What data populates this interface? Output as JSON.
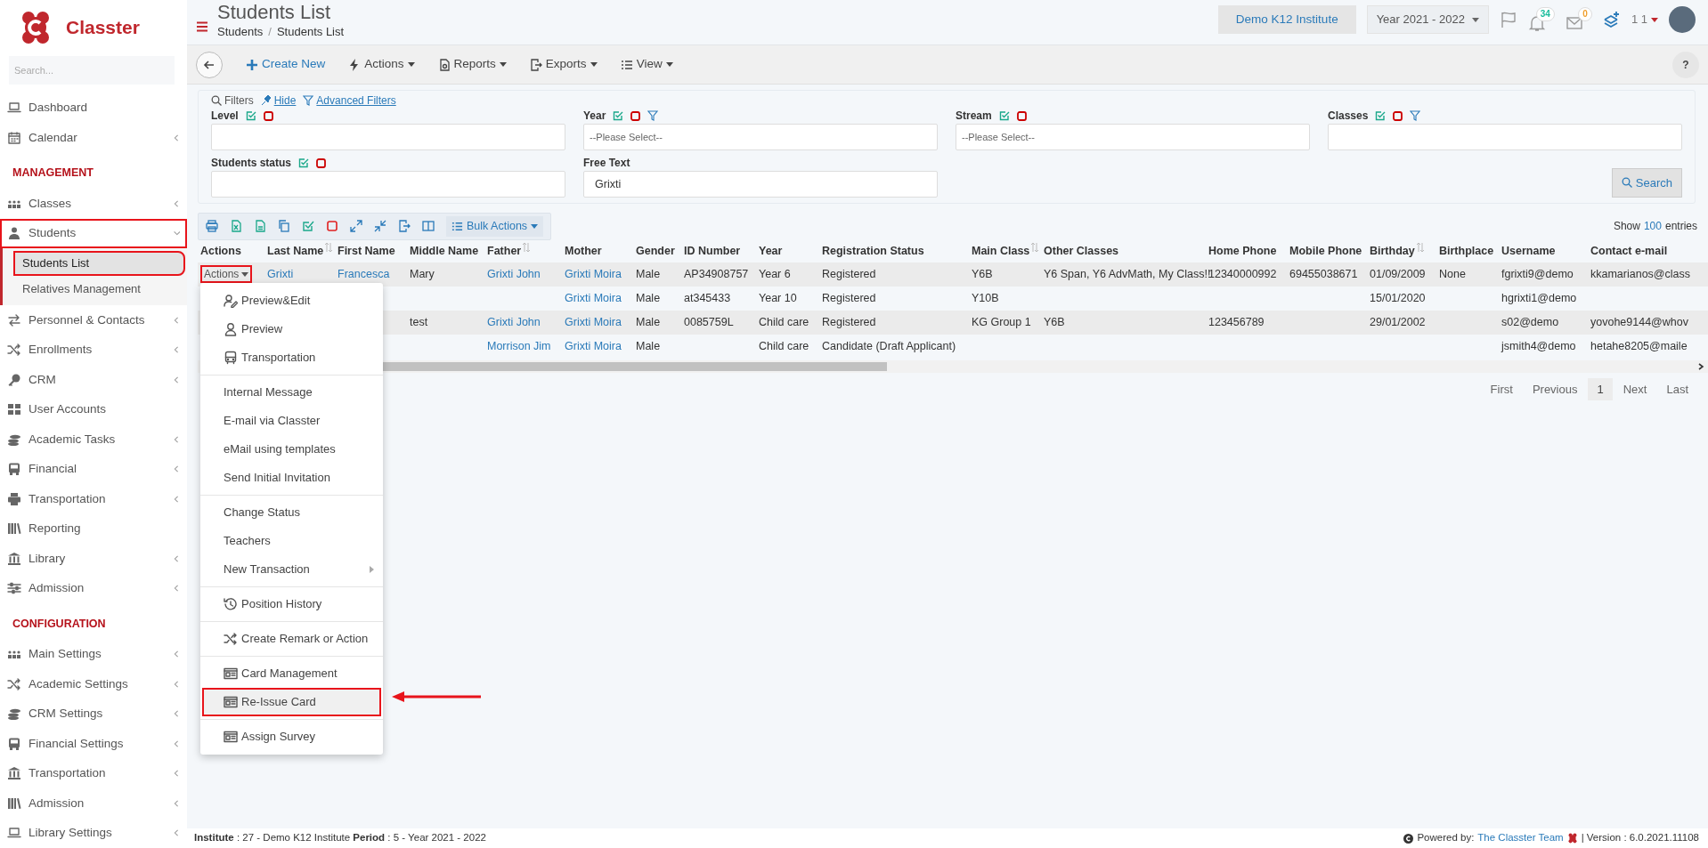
{
  "brand": {
    "name": "Classter"
  },
  "sidebar": {
    "search_placeholder": "Search...",
    "items": [
      {
        "kind": "item",
        "label": "Dashboard",
        "has_submenu": false,
        "highlighted": false
      },
      {
        "kind": "item",
        "label": "Calendar",
        "has_submenu": true,
        "highlighted": false
      },
      {
        "kind": "header",
        "label": "MANAGEMENT"
      },
      {
        "kind": "item",
        "label": "Classes",
        "has_submenu": true,
        "highlighted": false
      },
      {
        "kind": "item",
        "label": "Students",
        "has_submenu": true,
        "highlighted": true,
        "expanded": true,
        "children": [
          {
            "label": "Students List",
            "selected": true,
            "highlighted": true
          },
          {
            "label": "Relatives Management",
            "selected": false,
            "highlighted": false
          }
        ]
      },
      {
        "kind": "item",
        "label": "Personnel & Contacts",
        "has_submenu": true,
        "highlighted": false
      },
      {
        "kind": "item",
        "label": "Enrollments",
        "has_submenu": true,
        "highlighted": false
      },
      {
        "kind": "item",
        "label": "CRM",
        "has_submenu": true,
        "highlighted": false
      },
      {
        "kind": "item",
        "label": "User Accounts",
        "has_submenu": false,
        "highlighted": false
      },
      {
        "kind": "item",
        "label": "Academic Tasks",
        "has_submenu": true,
        "highlighted": false
      },
      {
        "kind": "item",
        "label": "Financial",
        "has_submenu": true,
        "highlighted": false
      },
      {
        "kind": "item",
        "label": "Transportation",
        "has_submenu": true,
        "highlighted": false
      },
      {
        "kind": "item",
        "label": "Reporting",
        "has_submenu": false,
        "highlighted": false
      },
      {
        "kind": "item",
        "label": "Library",
        "has_submenu": true,
        "highlighted": false
      },
      {
        "kind": "item",
        "label": "Admission",
        "has_submenu": true,
        "highlighted": false
      },
      {
        "kind": "header",
        "label": "CONFIGURATION"
      },
      {
        "kind": "item",
        "label": "Main Settings",
        "has_submenu": true,
        "highlighted": false
      },
      {
        "kind": "item",
        "label": "Academic Settings",
        "has_submenu": true,
        "highlighted": false
      },
      {
        "kind": "item",
        "label": "CRM Settings",
        "has_submenu": true,
        "highlighted": false
      },
      {
        "kind": "item",
        "label": "Financial Settings",
        "has_submenu": true,
        "highlighted": false
      },
      {
        "kind": "item",
        "label": "Transportation",
        "has_submenu": true,
        "highlighted": false
      },
      {
        "kind": "item",
        "label": "Admission",
        "has_submenu": true,
        "highlighted": false
      },
      {
        "kind": "item",
        "label": "Library Settings",
        "has_submenu": true,
        "highlighted": false
      }
    ]
  },
  "header": {
    "title": "Students List",
    "breadcrumb": [
      "Students",
      "Students List"
    ],
    "breadcrumb_separator": "/",
    "institute": "Demo K12 Institute",
    "year": "Year 2021 - 2022",
    "notifications_badge": "34",
    "messages_badge": "0",
    "user": "1 1"
  },
  "toolbar": {
    "buttons": [
      {
        "label": "Create New",
        "kind": "create"
      },
      {
        "label": "Actions",
        "kind": "dropdown"
      },
      {
        "label": "Reports",
        "kind": "dropdown"
      },
      {
        "label": "Exports",
        "kind": "dropdown"
      },
      {
        "label": "View",
        "kind": "dropdown"
      }
    ],
    "help": "?"
  },
  "filters": {
    "title": "Filters",
    "hide": "Hide",
    "advanced": "Advanced Filters",
    "search_button": "Search",
    "fields": [
      {
        "label": "Level",
        "has_filter": false
      },
      {
        "label": "Year",
        "has_filter": true,
        "placeholder": "--Please Select--"
      },
      {
        "label": "Stream",
        "has_filter": false,
        "placeholder": "--Please Select--"
      },
      {
        "label": "Classes",
        "has_filter": true
      },
      {
        "label": "Students status",
        "has_filter": false
      },
      {
        "label": "Free Text",
        "has_filter": false,
        "value": "Grixti",
        "plain": true
      }
    ]
  },
  "table_toolbar": {
    "bulk_actions": "Bulk Actions",
    "show": "Show",
    "page_size": "100",
    "entries": "entries"
  },
  "table": {
    "columns": [
      {
        "label": "Actions",
        "sort_icon": false
      },
      {
        "label": "Last Name",
        "sort_icon": true,
        "link": true
      },
      {
        "label": "First Name",
        "sort_icon": false,
        "link": true
      },
      {
        "label": "Middle Name",
        "sort_icon": false
      },
      {
        "label": "Father",
        "sort_icon": true,
        "link": true
      },
      {
        "label": "Mother",
        "sort_icon": false,
        "link": true
      },
      {
        "label": "Gender",
        "sort_icon": false
      },
      {
        "label": "ID Number",
        "sort_icon": false
      },
      {
        "label": "Year",
        "sort_icon": false
      },
      {
        "label": "Registration Status",
        "sort_icon": false
      },
      {
        "label": "Main Class",
        "sort_icon": true
      },
      {
        "label": "Other Classes",
        "sort_icon": false
      },
      {
        "label": "Home Phone",
        "sort_icon": false
      },
      {
        "label": "Mobile Phone",
        "sort_icon": false
      },
      {
        "label": "Birthday",
        "sort_icon": true
      },
      {
        "label": "Birthplace",
        "sort_icon": false
      },
      {
        "label": "Username",
        "sort_icon": false
      },
      {
        "label": "Contact e-mail",
        "sort_icon": false
      }
    ],
    "rows": [
      {
        "actions": {
          "label": "Actions",
          "highlighted": true
        },
        "cells": [
          null,
          "Grixti",
          "Francesca",
          "Mary",
          "Grixti John",
          "Grixti Moira",
          "Male",
          "AP34908757",
          "Year 6",
          "Registered",
          "Y6B",
          "Y6 Span, Y6 AdvMath, My Class!!",
          "12340000992",
          "69455038671",
          "01/09/2009",
          "None",
          "fgrixti9@demo",
          "kkamarianos@class"
        ]
      },
      {
        "cells": [
          null,
          null,
          null,
          null,
          null,
          "Grixti Moira",
          "Male",
          "at345433",
          "Year 10",
          "Registered",
          "Y10B",
          null,
          null,
          null,
          "15/01/2020",
          null,
          "hgrixti1@demo",
          null
        ]
      },
      {
        "cells": [
          null,
          null,
          null,
          "test",
          "Grixti John",
          "Grixti Moira",
          "Male",
          "0085759L",
          "Child care",
          "Registered",
          "KG Group 1",
          "Y6B",
          "123456789",
          null,
          "29/01/2002",
          null,
          "s02@demo",
          "yovohe9144@whov"
        ]
      },
      {
        "cells": [
          null,
          null,
          null,
          null,
          "Morrison Jim",
          "Grixti Moira",
          "Male",
          null,
          "Child care",
          "Candidate (Draft Applicant)",
          null,
          null,
          null,
          null,
          null,
          null,
          "jsmith4@demo",
          "hetahe8205@maile"
        ]
      }
    ]
  },
  "context_menu": {
    "groups": [
      [
        {
          "label": "Preview&Edit",
          "highlighted": false
        },
        {
          "label": "Preview",
          "highlighted": false
        },
        {
          "label": "Transportation",
          "highlighted": false
        }
      ],
      [
        {
          "label": "Internal Message",
          "highlighted": false
        },
        {
          "label": "E-mail via Classter",
          "highlighted": false
        },
        {
          "label": "eMail using templates",
          "highlighted": false
        },
        {
          "label": "Send Initial Invitation",
          "highlighted": false
        }
      ],
      [
        {
          "label": "Change Status",
          "highlighted": false
        },
        {
          "label": "Teachers",
          "highlighted": false
        },
        {
          "label": "New Transaction",
          "highlighted": false,
          "submenu": true
        }
      ],
      [
        {
          "label": "Position History",
          "highlighted": false
        }
      ],
      [
        {
          "label": "Create Remark or Action",
          "highlighted": false
        }
      ],
      [
        {
          "label": "Card Management",
          "highlighted": false
        },
        {
          "label": "Re-Issue Card",
          "highlighted": true
        }
      ],
      [
        {
          "label": "Assign Survey",
          "highlighted": false
        }
      ]
    ]
  },
  "pagination": [
    {
      "label": "First",
      "selected": false
    },
    {
      "label": "Previous",
      "selected": false
    },
    {
      "label": "1",
      "selected": true
    },
    {
      "label": "Next",
      "selected": false
    },
    {
      "label": "Last",
      "selected": false
    }
  ],
  "footer": {
    "info": "**Institute** : 27 - Demo K12 Institute **Period** : 5 - Year 2021 - 2022",
    "powered_by": "Powered by:",
    "team": "The Classter Team",
    "version": "| Version : 6.0.2021.11108"
  }
}
